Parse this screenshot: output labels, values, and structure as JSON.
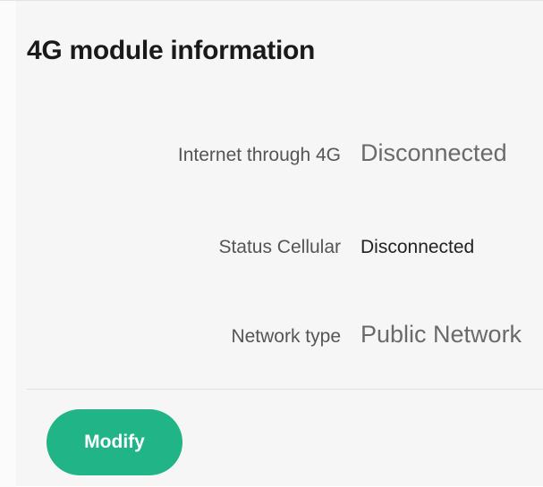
{
  "section": {
    "title": "4G module information"
  },
  "fields": {
    "internet": {
      "label": "Internet through 4G",
      "value": "Disconnected"
    },
    "status": {
      "label": "Status Cellular",
      "value": "Disconnected"
    },
    "network": {
      "label": "Network type",
      "value": "Public Network"
    }
  },
  "actions": {
    "modify_label": "Modify"
  },
  "colors": {
    "accent": "#20b487",
    "background": "#f6f6f6",
    "label_text": "#555555",
    "value_text": "#6a6a6a"
  }
}
